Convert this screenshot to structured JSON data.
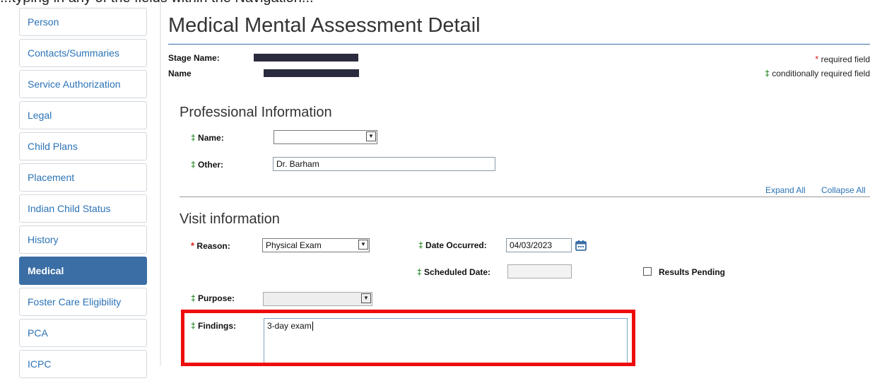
{
  "top_fragment": "...typing in any of the fields within the Navigation...",
  "sidebar": {
    "items": [
      {
        "label": "Person"
      },
      {
        "label": "Contacts/Summaries"
      },
      {
        "label": "Service Authorization"
      },
      {
        "label": "Legal"
      },
      {
        "label": "Child Plans"
      },
      {
        "label": "Placement"
      },
      {
        "label": "Indian Child Status"
      },
      {
        "label": "History"
      },
      {
        "label": "Medical",
        "active": true
      },
      {
        "label": "Foster Care Eligibility"
      },
      {
        "label": "PCA"
      },
      {
        "label": "ICPC"
      }
    ]
  },
  "header": {
    "title": "Medical Mental Assessment Detail",
    "stage_name_label": "Stage Name:",
    "name_label": "Name",
    "required_legend": "required field",
    "conditional_legend": "conditionally required field",
    "required_marker": "*",
    "conditional_marker": "‡"
  },
  "professional": {
    "heading": "Professional Information",
    "name_label": "Name:",
    "name_value": "",
    "other_label": "Other:",
    "other_value": "Dr. Barham"
  },
  "toolbar": {
    "expand_all": "Expand All",
    "collapse_all": "Collapse All"
  },
  "visit": {
    "heading": "Visit information",
    "reason_label": "Reason:",
    "reason_value": "Physical Exam",
    "date_occurred_label": "Date Occurred:",
    "date_occurred_value": "04/03/2023",
    "scheduled_date_label": "Scheduled Date:",
    "scheduled_date_value": "",
    "results_pending_label": "Results Pending",
    "results_pending_checked": false,
    "purpose_label": "Purpose:",
    "purpose_value": "",
    "findings_label": "Findings:",
    "findings_value": "3-day exam"
  },
  "colors": {
    "accent": "#3a6ea5",
    "link": "#2b73b5",
    "required": "#d62020",
    "conditional": "#2a8b2a",
    "highlight": "#ee0d0d"
  }
}
